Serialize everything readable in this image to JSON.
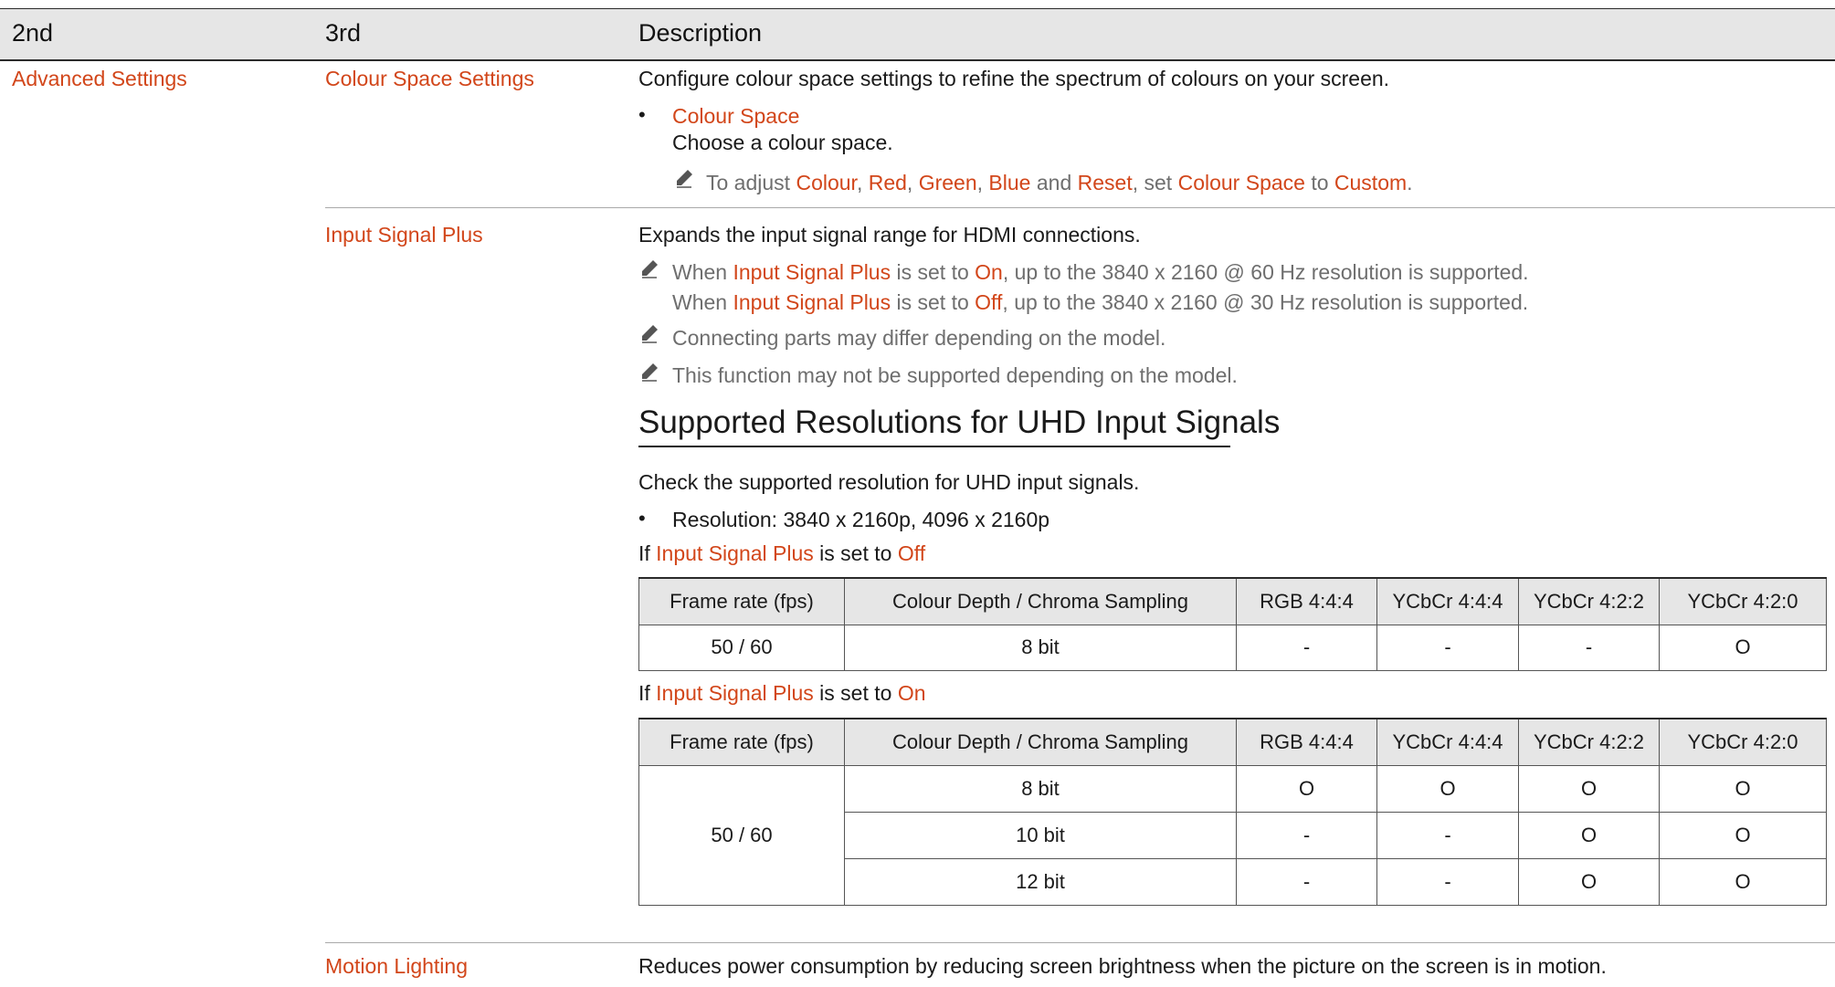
{
  "header": {
    "col1": "2nd",
    "col2": "3rd",
    "col3": "Description"
  },
  "advanced_settings": {
    "label": "Advanced Settings"
  },
  "colour_space_settings": {
    "label": "Colour Space Settings",
    "description": "Configure colour space settings to refine the spectrum of colours on your screen.",
    "bullet_title": "Colour Space",
    "bullet_text": "Choose a colour space.",
    "note": {
      "p1": "To adjust ",
      "colour": "Colour",
      "sep1": ", ",
      "red": "Red",
      "sep2": ", ",
      "green": "Green",
      "sep3": ", ",
      "blue": "Blue",
      "and": " and ",
      "reset": "Reset",
      "p2": ", set ",
      "colour_space": "Colour Space",
      "to": " to ",
      "custom": "Custom",
      "end": "."
    }
  },
  "input_signal_plus": {
    "label": "Input Signal Plus",
    "description": "Expands the input signal range for HDMI connections.",
    "note1": {
      "w1": "When ",
      "isp1": "Input Signal Plus",
      "m1": " is set to ",
      "on": "On",
      "r1": ", up to the 3840 x 2160 @ 60 Hz resolution is supported.",
      "w2": "When ",
      "isp2": "Input Signal Plus",
      "m2": " is set to ",
      "off": "Off",
      "r2": ", up to the 3840 x 2160 @ 30 Hz resolution is supported."
    },
    "note2": "Connecting parts may differ depending on the model.",
    "note3": "This function may not be supported depending on the model."
  },
  "uhd_section": {
    "heading": "Supported Resolutions for UHD Input Signals",
    "intro": "Check the supported resolution for UHD input signals.",
    "resolution": "Resolution: 3840 x 2160p, 4096 x 2160p",
    "off_caption": {
      "if": "If ",
      "isp": "Input Signal Plus",
      "mid": " is set to ",
      "val": "Off"
    },
    "on_caption": {
      "if": "If ",
      "isp": "Input Signal Plus",
      "mid": " is set to ",
      "val": "On"
    },
    "columns": [
      "Frame rate (fps)",
      "Colour Depth / Chroma Sampling",
      "RGB 4:4:4",
      "YCbCr 4:4:4",
      "YCbCr 4:2:2",
      "YCbCr 4:2:0"
    ],
    "off_table": {
      "rows": [
        {
          "fps": "50 / 60",
          "depth": "8 bit",
          "rgb444": "-",
          "ycbcr444": "-",
          "ycbcr422": "-",
          "ycbcr420": "O"
        }
      ]
    },
    "on_table": {
      "fps": "50 / 60",
      "rows": [
        {
          "depth": "8 bit",
          "rgb444": "O",
          "ycbcr444": "O",
          "ycbcr422": "O",
          "ycbcr420": "O"
        },
        {
          "depth": "10 bit",
          "rgb444": "-",
          "ycbcr444": "-",
          "ycbcr422": "O",
          "ycbcr420": "O"
        },
        {
          "depth": "12 bit",
          "rgb444": "-",
          "ycbcr444": "-",
          "ycbcr422": "O",
          "ycbcr420": "O"
        }
      ]
    }
  },
  "motion_lighting": {
    "label": "Motion Lighting",
    "description": "Reduces power consumption by reducing screen brightness when the picture on the screen is in motion."
  },
  "colors": {
    "accent": "#d2461a",
    "note_gray": "#6e6e6e",
    "header_bg": "#e6e6e6"
  },
  "icons": {
    "note": "pencil-icon",
    "bullet": "bullet-dot"
  }
}
